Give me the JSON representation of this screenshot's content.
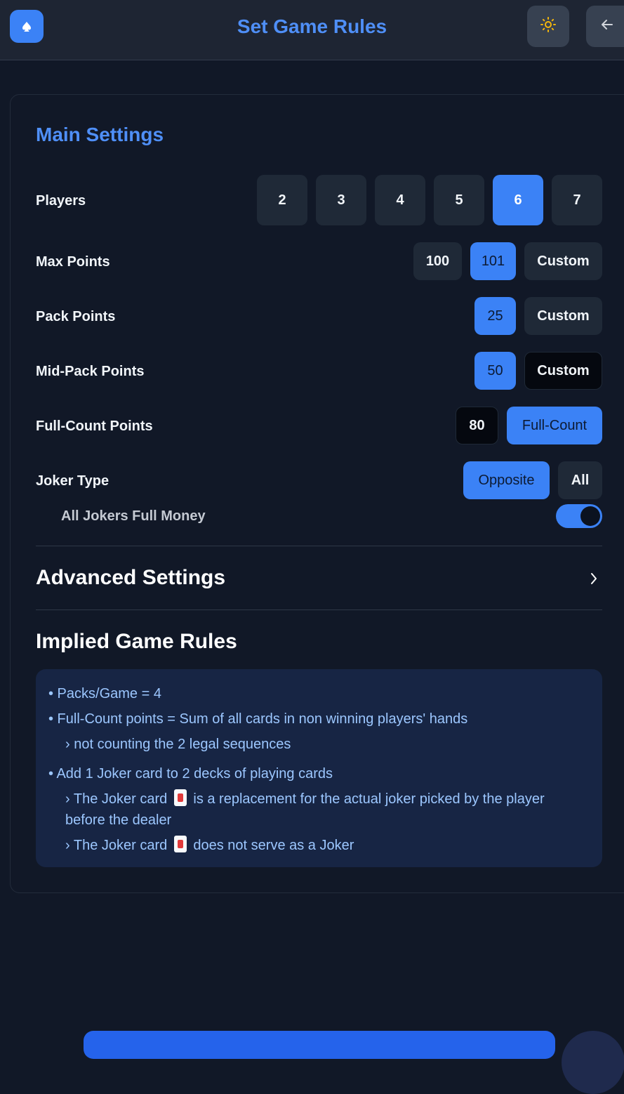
{
  "header": {
    "title": "Set Game Rules",
    "logo_icon": "spade-icon",
    "theme_icon": "sun-icon",
    "back_icon": "arrow-left-icon"
  },
  "main_settings": {
    "title": "Main Settings",
    "players": {
      "label": "Players",
      "options": [
        "2",
        "3",
        "4",
        "5",
        "6",
        "7"
      ],
      "selected": "6"
    },
    "max_points": {
      "label": "Max Points",
      "options": [
        "100",
        "101",
        "Custom"
      ],
      "selected": "101"
    },
    "pack_points": {
      "label": "Pack Points",
      "options": [
        "25",
        "Custom"
      ],
      "selected": "25"
    },
    "mid_pack_points": {
      "label": "Mid-Pack Points",
      "options": [
        "50",
        "Custom"
      ],
      "selected": "50"
    },
    "full_count_points": {
      "label": "Full-Count Points",
      "options": [
        "80",
        "Full-Count"
      ],
      "selected": "Full-Count"
    },
    "joker_type": {
      "label": "Joker Type",
      "options": [
        "Opposite",
        "All"
      ],
      "selected": "Opposite"
    },
    "all_jokers_full_money": {
      "label": "All Jokers Full Money",
      "enabled": true
    }
  },
  "advanced_settings": {
    "title": "Advanced Settings"
  },
  "implied_rules": {
    "title": "Implied Game Rules",
    "r1": "• Packs/Game = 4",
    "r2": "• Full-Count points = Sum of all cards in non winning players' hands",
    "r2a": "› not counting the 2 legal sequences",
    "r3": "• Add 1 Joker card to 2 decks of playing cards",
    "r3a_pre": "› The Joker card",
    "r3a_post": "is a replacement for the actual joker picked by the player before the dealer",
    "r3b_pre": "› The Joker card",
    "r3b_post": "does not serve as a Joker"
  },
  "colors": {
    "accent": "#3b82f6",
    "background": "#111827",
    "rule_text": "#9cc7ff"
  }
}
